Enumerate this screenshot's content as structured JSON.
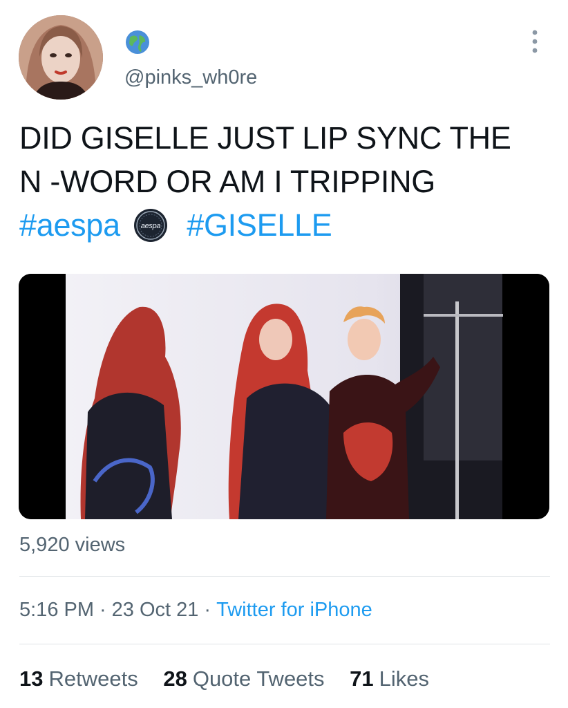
{
  "author": {
    "handle": "@pinks_wh0re",
    "avatar_icon": "profile-photo",
    "badge_icon": "globe-icon"
  },
  "tweet": {
    "line1": "DID GISELLE JUST LIP SYNC THE",
    "line2": "N -WORD OR AM I TRIPPING",
    "hashtag1": "#aespa",
    "hashflag_text": "aespa",
    "hashtag2": "#GISELLE"
  },
  "video": {
    "kind": "video-thumbnail"
  },
  "views": "5,920 views",
  "meta": {
    "time": "5:16 PM",
    "separator": "·",
    "date": "23 Oct 21",
    "source": "Twitter for iPhone"
  },
  "stats": {
    "retweets_count": "13",
    "retweets_label": "Retweets",
    "quotes_count": "28",
    "quotes_label": "Quote Tweets",
    "likes_count": "71",
    "likes_label": "Likes"
  },
  "colors": {
    "link": "#1d9bf0",
    "secondary_text": "#536471",
    "primary_text": "#0f1419"
  }
}
